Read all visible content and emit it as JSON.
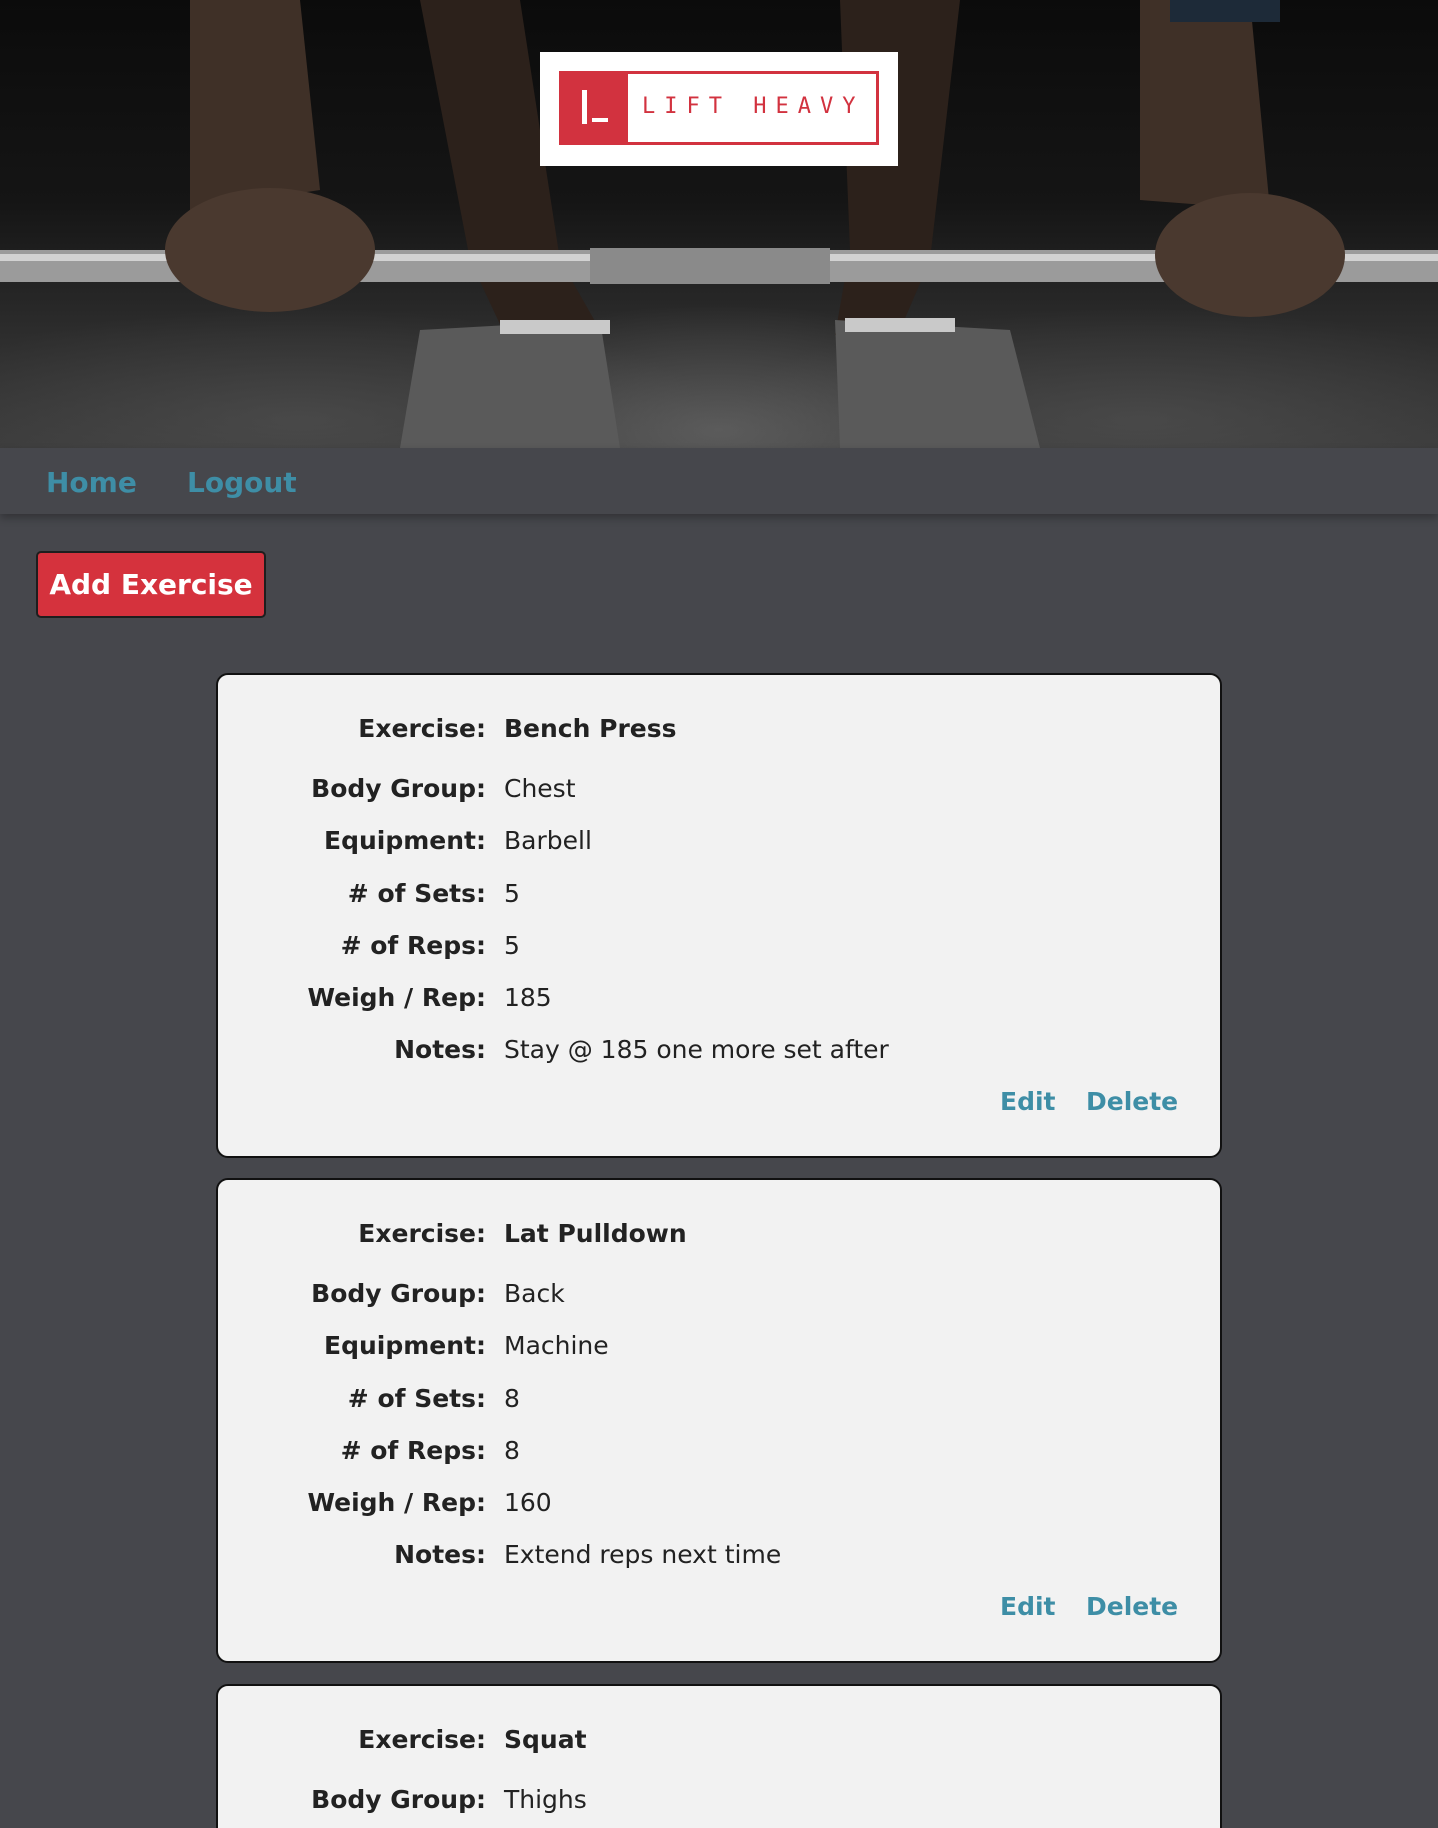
{
  "header": {
    "logo_text": "LIFT HEAVY",
    "brand_color": "#d2323f"
  },
  "nav": {
    "home_label": "Home",
    "logout_label": "Logout",
    "link_color": "#3e8ea6"
  },
  "actions": {
    "add_exercise_label": "Add Exercise"
  },
  "labels": {
    "exercise": "Exercise:",
    "body_group": "Body Group:",
    "equipment": "Equipment:",
    "sets": "# of Sets:",
    "reps": "# of Reps:",
    "weight": "Weigh / Rep:",
    "notes": "Notes:",
    "edit": "Edit",
    "delete": "Delete"
  },
  "exercises": [
    {
      "exercise": "Bench Press",
      "body_group": "Chest",
      "equipment": "Barbell",
      "sets": "5",
      "reps": "5",
      "weight": "185",
      "notes": "Stay @ 185 one more set after"
    },
    {
      "exercise": "Lat Pulldown",
      "body_group": "Back",
      "equipment": "Machine",
      "sets": "8",
      "reps": "8",
      "weight": "160",
      "notes": "Extend reps next time"
    },
    {
      "exercise": "Squat",
      "body_group": "Thighs"
    }
  ]
}
